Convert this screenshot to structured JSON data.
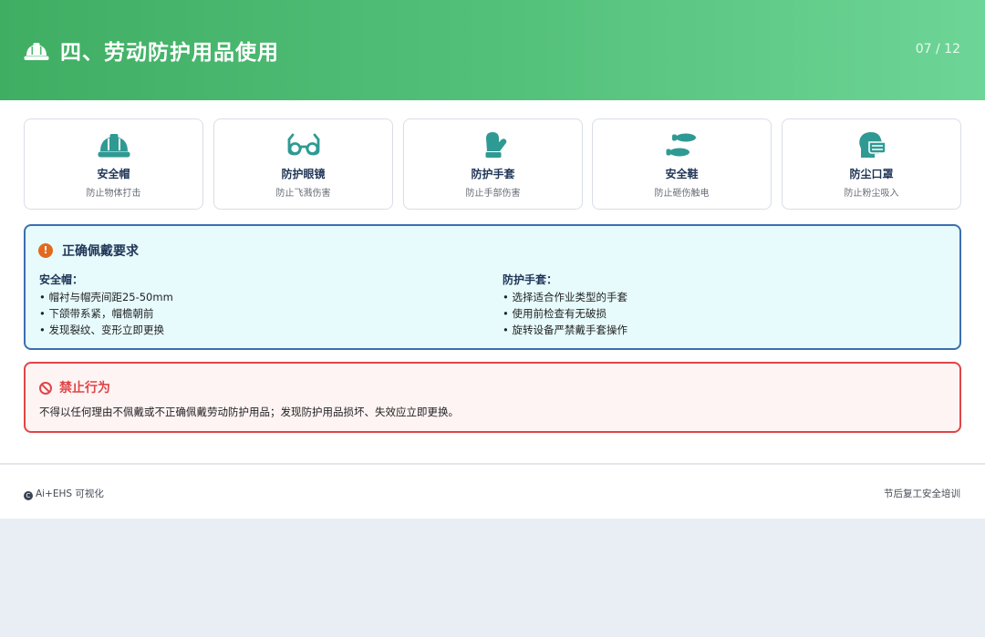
{
  "header": {
    "icon": "hard-hat-icon",
    "title": "四、劳动防护用品使用",
    "page": "07 / 12"
  },
  "colors": {
    "header_gradient_start": "#3fae63",
    "header_gradient_end": "#6dd597",
    "icon_teal": "#2f9a93",
    "requirement_border": "#3b6fb0",
    "requirement_bg": "#e7fbfd",
    "prohibited_border": "#e04546",
    "prohibited_bg": "#fff4f4"
  },
  "equipment": [
    {
      "icon": "hard-hat-icon",
      "name": "安全帽",
      "desc": "防止物体打击"
    },
    {
      "icon": "glasses-icon",
      "name": "防护眼镜",
      "desc": "防止飞溅伤害"
    },
    {
      "icon": "mitten-icon",
      "name": "防护手套",
      "desc": "防止手部伤害"
    },
    {
      "icon": "shoe-prints-icon",
      "name": "安全鞋",
      "desc": "防止砸伤触电"
    },
    {
      "icon": "head-mask-icon",
      "name": "防尘口罩",
      "desc": "防止粉尘吸入"
    }
  ],
  "requirements": {
    "icon": "exclamation-circle-icon",
    "title": "正确佩戴要求",
    "helmet": {
      "title": "安全帽：",
      "items": [
        "帽衬与帽壳间距25-50mm",
        "下颌带系紧，帽檐朝前",
        "发现裂纹、变形立即更换"
      ]
    },
    "gloves": {
      "title": "防护手套：",
      "items": [
        "选择适合作业类型的手套",
        "使用前检查有无破损",
        "旋转设备严禁戴手套操作"
      ]
    }
  },
  "prohibited": {
    "icon": "ban-icon",
    "title": "禁止行为",
    "text": "不得以任何理由不佩戴或不正确佩戴劳动防护用品；发现防护用品损坏、失效应立即更换。"
  },
  "footer": {
    "brand_icon": "copyright-icon",
    "left": "Ai+EHS 可视化",
    "right": "节后复工安全培训"
  }
}
